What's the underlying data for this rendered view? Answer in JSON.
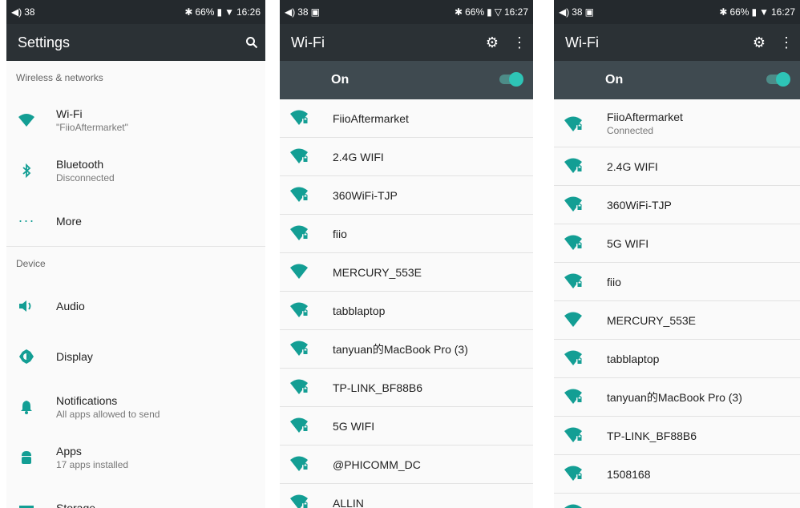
{
  "panel1": {
    "status": {
      "volume": "38",
      "battery": "66%",
      "time": "16:26"
    },
    "title": "Settings",
    "sections": [
      {
        "header": "Wireless & networks",
        "items": [
          {
            "icon": "wifi-icon",
            "title": "Wi-Fi",
            "subtitle": "\"FiioAftermarket\""
          },
          {
            "icon": "bluetooth-icon",
            "title": "Bluetooth",
            "subtitle": "Disconnected"
          },
          {
            "icon": "more-icon",
            "title": "More",
            "subtitle": ""
          }
        ]
      },
      {
        "header": "Device",
        "items": [
          {
            "icon": "audio-icon",
            "title": "Audio",
            "subtitle": ""
          },
          {
            "icon": "display-icon",
            "title": "Display",
            "subtitle": ""
          },
          {
            "icon": "notifications-icon",
            "title": "Notifications",
            "subtitle": "All apps allowed to send"
          },
          {
            "icon": "android-icon",
            "title": "Apps",
            "subtitle": "17 apps installed"
          },
          {
            "icon": "storage-icon",
            "title": "Storage",
            "subtitle": ""
          }
        ]
      }
    ]
  },
  "panel2": {
    "status": {
      "volume": "38",
      "battery": "66%",
      "time": "16:27"
    },
    "title": "Wi-Fi",
    "toggle_label": "On",
    "networks": [
      {
        "name": "FiioAftermarket",
        "status": "",
        "locked": true
      },
      {
        "name": "2.4G WIFI",
        "status": "",
        "locked": true
      },
      {
        "name": "360WiFi-TJP",
        "status": "",
        "locked": true
      },
      {
        "name": "fiio",
        "status": "",
        "locked": true
      },
      {
        "name": "MERCURY_553E",
        "status": "",
        "locked": false
      },
      {
        "name": "tabblaptop",
        "status": "",
        "locked": true
      },
      {
        "name": "tanyuan的MacBook Pro (3)",
        "status": "",
        "locked": true
      },
      {
        "name": "TP-LINK_BF88B6",
        "status": "",
        "locked": true
      },
      {
        "name": "5G WIFI",
        "status": "",
        "locked": true
      },
      {
        "name": "@PHICOMM_DC",
        "status": "",
        "locked": true
      },
      {
        "name": "ALLIN",
        "status": "",
        "locked": true
      }
    ]
  },
  "panel3": {
    "status": {
      "volume": "38",
      "battery": "66%",
      "time": "16:27"
    },
    "title": "Wi-Fi",
    "toggle_label": "On",
    "networks": [
      {
        "name": "FiioAftermarket",
        "status": "Connected",
        "locked": true
      },
      {
        "name": "2.4G WIFI",
        "status": "",
        "locked": true
      },
      {
        "name": "360WiFi-TJP",
        "status": "",
        "locked": true
      },
      {
        "name": "5G WIFI",
        "status": "",
        "locked": true
      },
      {
        "name": "fiio",
        "status": "",
        "locked": true
      },
      {
        "name": "MERCURY_553E",
        "status": "",
        "locked": false
      },
      {
        "name": "tabblaptop",
        "status": "",
        "locked": true
      },
      {
        "name": "tanyuan的MacBook Pro (3)",
        "status": "",
        "locked": true
      },
      {
        "name": "TP-LINK_BF88B6",
        "status": "",
        "locked": true
      },
      {
        "name": "1508168",
        "status": "",
        "locked": true
      },
      {
        "name": "",
        "status": "",
        "locked": true
      }
    ]
  },
  "colors": {
    "accent": "#139e94",
    "appbar": "#2b3135",
    "statusbar": "#24292d",
    "toggle_row": "#3f4a50",
    "switch_knob": "#2ec4b6"
  }
}
